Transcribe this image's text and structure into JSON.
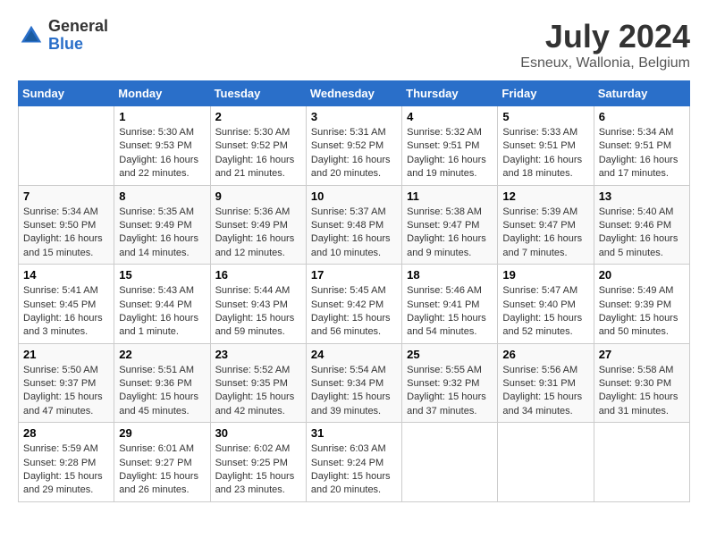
{
  "header": {
    "logo_general": "General",
    "logo_blue": "Blue",
    "month_year": "July 2024",
    "location": "Esneux, Wallonia, Belgium"
  },
  "weekdays": [
    "Sunday",
    "Monday",
    "Tuesday",
    "Wednesday",
    "Thursday",
    "Friday",
    "Saturday"
  ],
  "weeks": [
    [
      {
        "day": "",
        "info": ""
      },
      {
        "day": "1",
        "info": "Sunrise: 5:30 AM\nSunset: 9:53 PM\nDaylight: 16 hours\nand 22 minutes."
      },
      {
        "day": "2",
        "info": "Sunrise: 5:30 AM\nSunset: 9:52 PM\nDaylight: 16 hours\nand 21 minutes."
      },
      {
        "day": "3",
        "info": "Sunrise: 5:31 AM\nSunset: 9:52 PM\nDaylight: 16 hours\nand 20 minutes."
      },
      {
        "day": "4",
        "info": "Sunrise: 5:32 AM\nSunset: 9:51 PM\nDaylight: 16 hours\nand 19 minutes."
      },
      {
        "day": "5",
        "info": "Sunrise: 5:33 AM\nSunset: 9:51 PM\nDaylight: 16 hours\nand 18 minutes."
      },
      {
        "day": "6",
        "info": "Sunrise: 5:34 AM\nSunset: 9:51 PM\nDaylight: 16 hours\nand 17 minutes."
      }
    ],
    [
      {
        "day": "7",
        "info": "Sunrise: 5:34 AM\nSunset: 9:50 PM\nDaylight: 16 hours\nand 15 minutes."
      },
      {
        "day": "8",
        "info": "Sunrise: 5:35 AM\nSunset: 9:49 PM\nDaylight: 16 hours\nand 14 minutes."
      },
      {
        "day": "9",
        "info": "Sunrise: 5:36 AM\nSunset: 9:49 PM\nDaylight: 16 hours\nand 12 minutes."
      },
      {
        "day": "10",
        "info": "Sunrise: 5:37 AM\nSunset: 9:48 PM\nDaylight: 16 hours\nand 10 minutes."
      },
      {
        "day": "11",
        "info": "Sunrise: 5:38 AM\nSunset: 9:47 PM\nDaylight: 16 hours\nand 9 minutes."
      },
      {
        "day": "12",
        "info": "Sunrise: 5:39 AM\nSunset: 9:47 PM\nDaylight: 16 hours\nand 7 minutes."
      },
      {
        "day": "13",
        "info": "Sunrise: 5:40 AM\nSunset: 9:46 PM\nDaylight: 16 hours\nand 5 minutes."
      }
    ],
    [
      {
        "day": "14",
        "info": "Sunrise: 5:41 AM\nSunset: 9:45 PM\nDaylight: 16 hours\nand 3 minutes."
      },
      {
        "day": "15",
        "info": "Sunrise: 5:43 AM\nSunset: 9:44 PM\nDaylight: 16 hours\nand 1 minute."
      },
      {
        "day": "16",
        "info": "Sunrise: 5:44 AM\nSunset: 9:43 PM\nDaylight: 15 hours\nand 59 minutes."
      },
      {
        "day": "17",
        "info": "Sunrise: 5:45 AM\nSunset: 9:42 PM\nDaylight: 15 hours\nand 56 minutes."
      },
      {
        "day": "18",
        "info": "Sunrise: 5:46 AM\nSunset: 9:41 PM\nDaylight: 15 hours\nand 54 minutes."
      },
      {
        "day": "19",
        "info": "Sunrise: 5:47 AM\nSunset: 9:40 PM\nDaylight: 15 hours\nand 52 minutes."
      },
      {
        "day": "20",
        "info": "Sunrise: 5:49 AM\nSunset: 9:39 PM\nDaylight: 15 hours\nand 50 minutes."
      }
    ],
    [
      {
        "day": "21",
        "info": "Sunrise: 5:50 AM\nSunset: 9:37 PM\nDaylight: 15 hours\nand 47 minutes."
      },
      {
        "day": "22",
        "info": "Sunrise: 5:51 AM\nSunset: 9:36 PM\nDaylight: 15 hours\nand 45 minutes."
      },
      {
        "day": "23",
        "info": "Sunrise: 5:52 AM\nSunset: 9:35 PM\nDaylight: 15 hours\nand 42 minutes."
      },
      {
        "day": "24",
        "info": "Sunrise: 5:54 AM\nSunset: 9:34 PM\nDaylight: 15 hours\nand 39 minutes."
      },
      {
        "day": "25",
        "info": "Sunrise: 5:55 AM\nSunset: 9:32 PM\nDaylight: 15 hours\nand 37 minutes."
      },
      {
        "day": "26",
        "info": "Sunrise: 5:56 AM\nSunset: 9:31 PM\nDaylight: 15 hours\nand 34 minutes."
      },
      {
        "day": "27",
        "info": "Sunrise: 5:58 AM\nSunset: 9:30 PM\nDaylight: 15 hours\nand 31 minutes."
      }
    ],
    [
      {
        "day": "28",
        "info": "Sunrise: 5:59 AM\nSunset: 9:28 PM\nDaylight: 15 hours\nand 29 minutes."
      },
      {
        "day": "29",
        "info": "Sunrise: 6:01 AM\nSunset: 9:27 PM\nDaylight: 15 hours\nand 26 minutes."
      },
      {
        "day": "30",
        "info": "Sunrise: 6:02 AM\nSunset: 9:25 PM\nDaylight: 15 hours\nand 23 minutes."
      },
      {
        "day": "31",
        "info": "Sunrise: 6:03 AM\nSunset: 9:24 PM\nDaylight: 15 hours\nand 20 minutes."
      },
      {
        "day": "",
        "info": ""
      },
      {
        "day": "",
        "info": ""
      },
      {
        "day": "",
        "info": ""
      }
    ]
  ]
}
